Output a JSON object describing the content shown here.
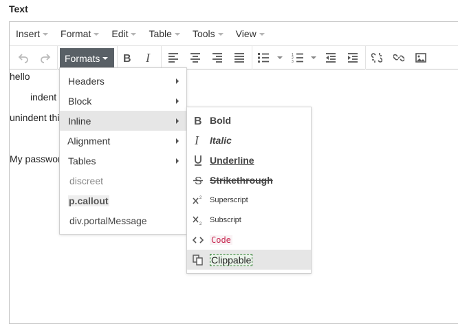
{
  "field": {
    "label": "Text"
  },
  "menubar": {
    "items": [
      {
        "label": "Insert"
      },
      {
        "label": "Format"
      },
      {
        "label": "Edit"
      },
      {
        "label": "Table"
      },
      {
        "label": "Tools"
      },
      {
        "label": "View"
      }
    ]
  },
  "toolbar": {
    "formats_label": "Formats",
    "icons": [
      "undo-icon",
      "redo-icon",
      "bold-icon",
      "italic-icon",
      "align-left-icon",
      "align-center-icon",
      "align-right-icon",
      "align-justify-icon",
      "bullet-list-icon",
      "numbered-list-icon",
      "outdent-icon",
      "indent-icon",
      "unlink-icon",
      "link-icon",
      "image-icon"
    ]
  },
  "content": {
    "lines": [
      "hello",
      "indent",
      "unindent thi",
      "My passwor"
    ]
  },
  "formats_menu": {
    "items": [
      {
        "label": "Headers",
        "submenu": true
      },
      {
        "label": "Block",
        "submenu": true
      },
      {
        "label": "Inline",
        "submenu": true,
        "active": true
      },
      {
        "label": "Alignment",
        "submenu": true
      },
      {
        "label": "Tables",
        "submenu": true
      },
      {
        "label": "discreet"
      },
      {
        "label": "p.callout"
      },
      {
        "label": "div.portalMessage"
      }
    ]
  },
  "inline_menu": {
    "items": [
      {
        "label": "Bold",
        "icon": "bold-icon"
      },
      {
        "label": "Italic",
        "icon": "italic-icon"
      },
      {
        "label": "Underline",
        "icon": "underline-icon"
      },
      {
        "label": "Strikethrough",
        "icon": "strikethrough-icon"
      },
      {
        "label": "Superscript",
        "icon": "superscript-icon"
      },
      {
        "label": "Subscript",
        "icon": "subscript-icon"
      },
      {
        "label": "Code",
        "icon": "code-icon"
      },
      {
        "label": "Clippable",
        "icon": "clippable-icon",
        "active": true
      }
    ]
  },
  "colors": {
    "formats_button_bg": "#596066",
    "active_item_bg": "#e6e6e6",
    "code_text": "#c7254e",
    "code_bg": "#f9f2f4"
  }
}
